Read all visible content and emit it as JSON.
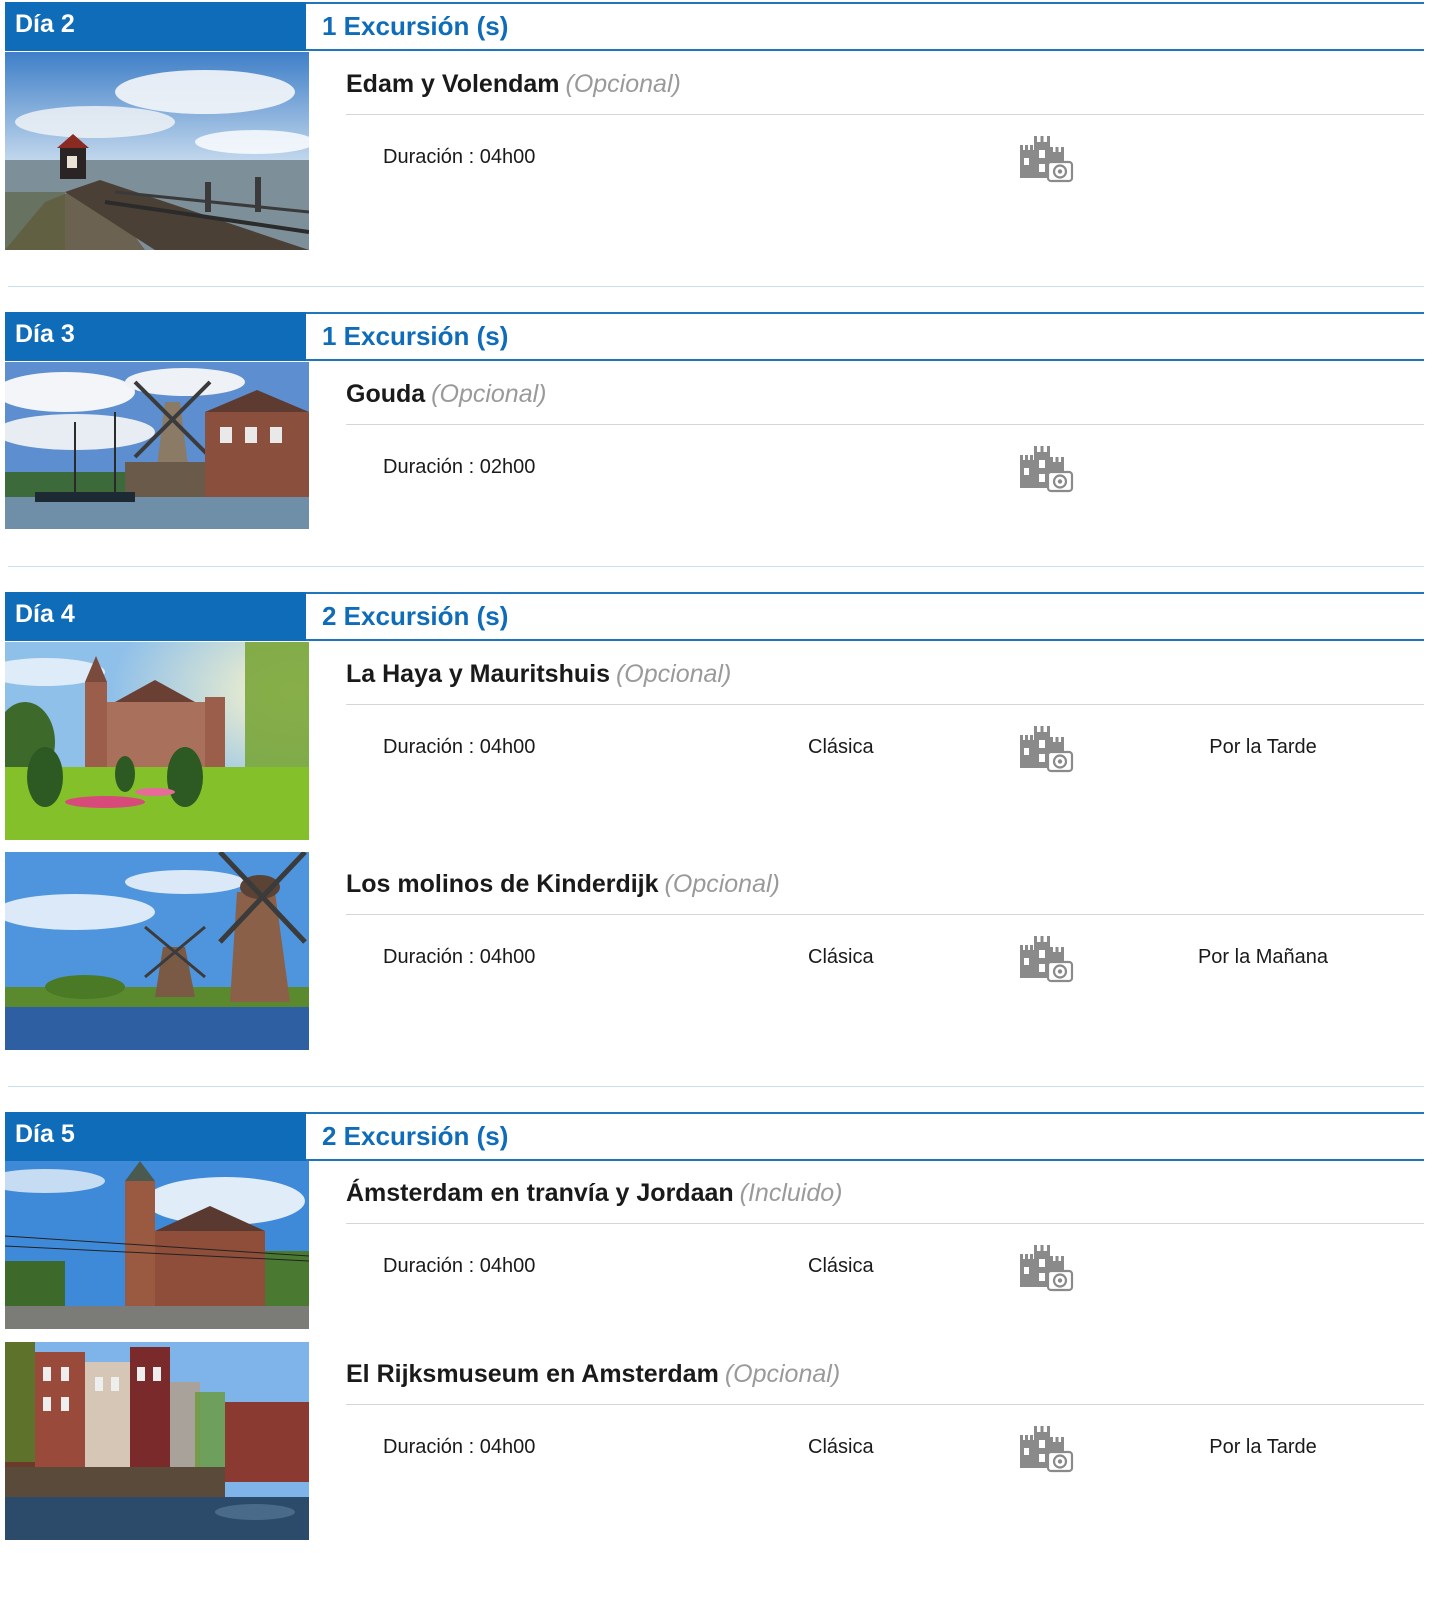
{
  "colors": {
    "accent": "#0f6cb8",
    "badge_text": "#ffffff",
    "tag": "#9a9a9a",
    "icon": "#8a8a8a"
  },
  "labels": {
    "duration_label": "Duración : "
  },
  "days": [
    {
      "label": "Día 2",
      "count_text": "1 Excursión (s)",
      "excursions": [
        {
          "title": "Edam y Volendam",
          "tag": "(Opcional)",
          "duration": "04h00",
          "category": "",
          "schedule": "",
          "icon": "castle-camera-icon",
          "image": "volendam-pier-lighthouse-photo"
        }
      ]
    },
    {
      "label": "Día 3",
      "count_text": "1 Excursión (s)",
      "excursions": [
        {
          "title": "Gouda",
          "tag": "(Opcional)",
          "duration": "02h00",
          "category": "",
          "schedule": "",
          "icon": "castle-camera-icon",
          "image": "gouda-windmill-canal-photo"
        }
      ]
    },
    {
      "label": "Día 4",
      "count_text": "2 Excursión (s)",
      "excursions": [
        {
          "title": "La Haya y Mauritshuis",
          "tag": "(Opcional)",
          "duration": "04h00",
          "category": "Clásica",
          "schedule": "Por la Tarde",
          "icon": "castle-camera-icon",
          "image": "peace-palace-garden-photo"
        },
        {
          "title": "Los molinos de Kinderdijk",
          "tag": "(Opcional)",
          "duration": "04h00",
          "category": "Clásica",
          "schedule": "Por la Mañana",
          "icon": "castle-camera-icon",
          "image": "kinderdijk-windmills-photo"
        }
      ]
    },
    {
      "label": "Día 5",
      "count_text": "2 Excursión (s)",
      "excursions": [
        {
          "title": "Ámsterdam en tranvía y Jordaan",
          "tag": "(Incluido)",
          "duration": "04h00",
          "category": "Clásica",
          "schedule": "",
          "icon": "castle-camera-icon",
          "image": "westerkerk-church-photo"
        },
        {
          "title": "El Rijksmuseum en Amsterdam",
          "tag": "(Opcional)",
          "duration": "04h00",
          "category": "Clásica",
          "schedule": "Por la Tarde",
          "icon": "castle-camera-icon",
          "image": "amsterdam-canal-houses-photo"
        }
      ]
    }
  ]
}
